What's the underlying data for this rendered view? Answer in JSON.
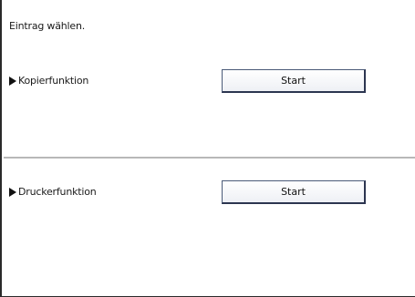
{
  "screen": {
    "instruction": "Eintrag wählen."
  },
  "functions": [
    {
      "label": "Kopierfunktion",
      "button_label": "Start"
    },
    {
      "label": "Druckerfunktion",
      "button_label": "Start"
    }
  ],
  "icons": {
    "row_marker": "triangle-right-icon"
  }
}
